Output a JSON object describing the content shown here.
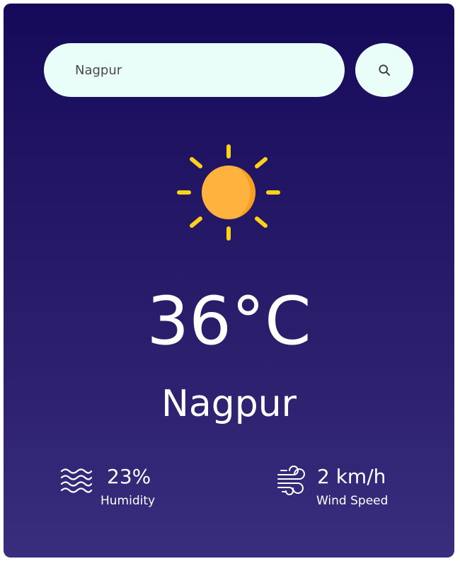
{
  "search": {
    "value": "Nagpur",
    "placeholder": "",
    "button_icon": "search-icon"
  },
  "weather": {
    "icon": "sun-icon",
    "temperature": "36°C",
    "city": "Nagpur"
  },
  "details": {
    "humidity": {
      "icon": "humidity-waves-icon",
      "value": "23%",
      "label": "Humidity"
    },
    "wind": {
      "icon": "wind-icon",
      "value": "2 km/h",
      "label": "Wind Speed"
    }
  },
  "colors": {
    "background_top": "#15095a",
    "background_bottom": "#392d7e",
    "input_background": "#e9fdf9",
    "sun_rays": "#ffd21a",
    "sun_body": "#ffb23d",
    "text": "#ffffff"
  }
}
